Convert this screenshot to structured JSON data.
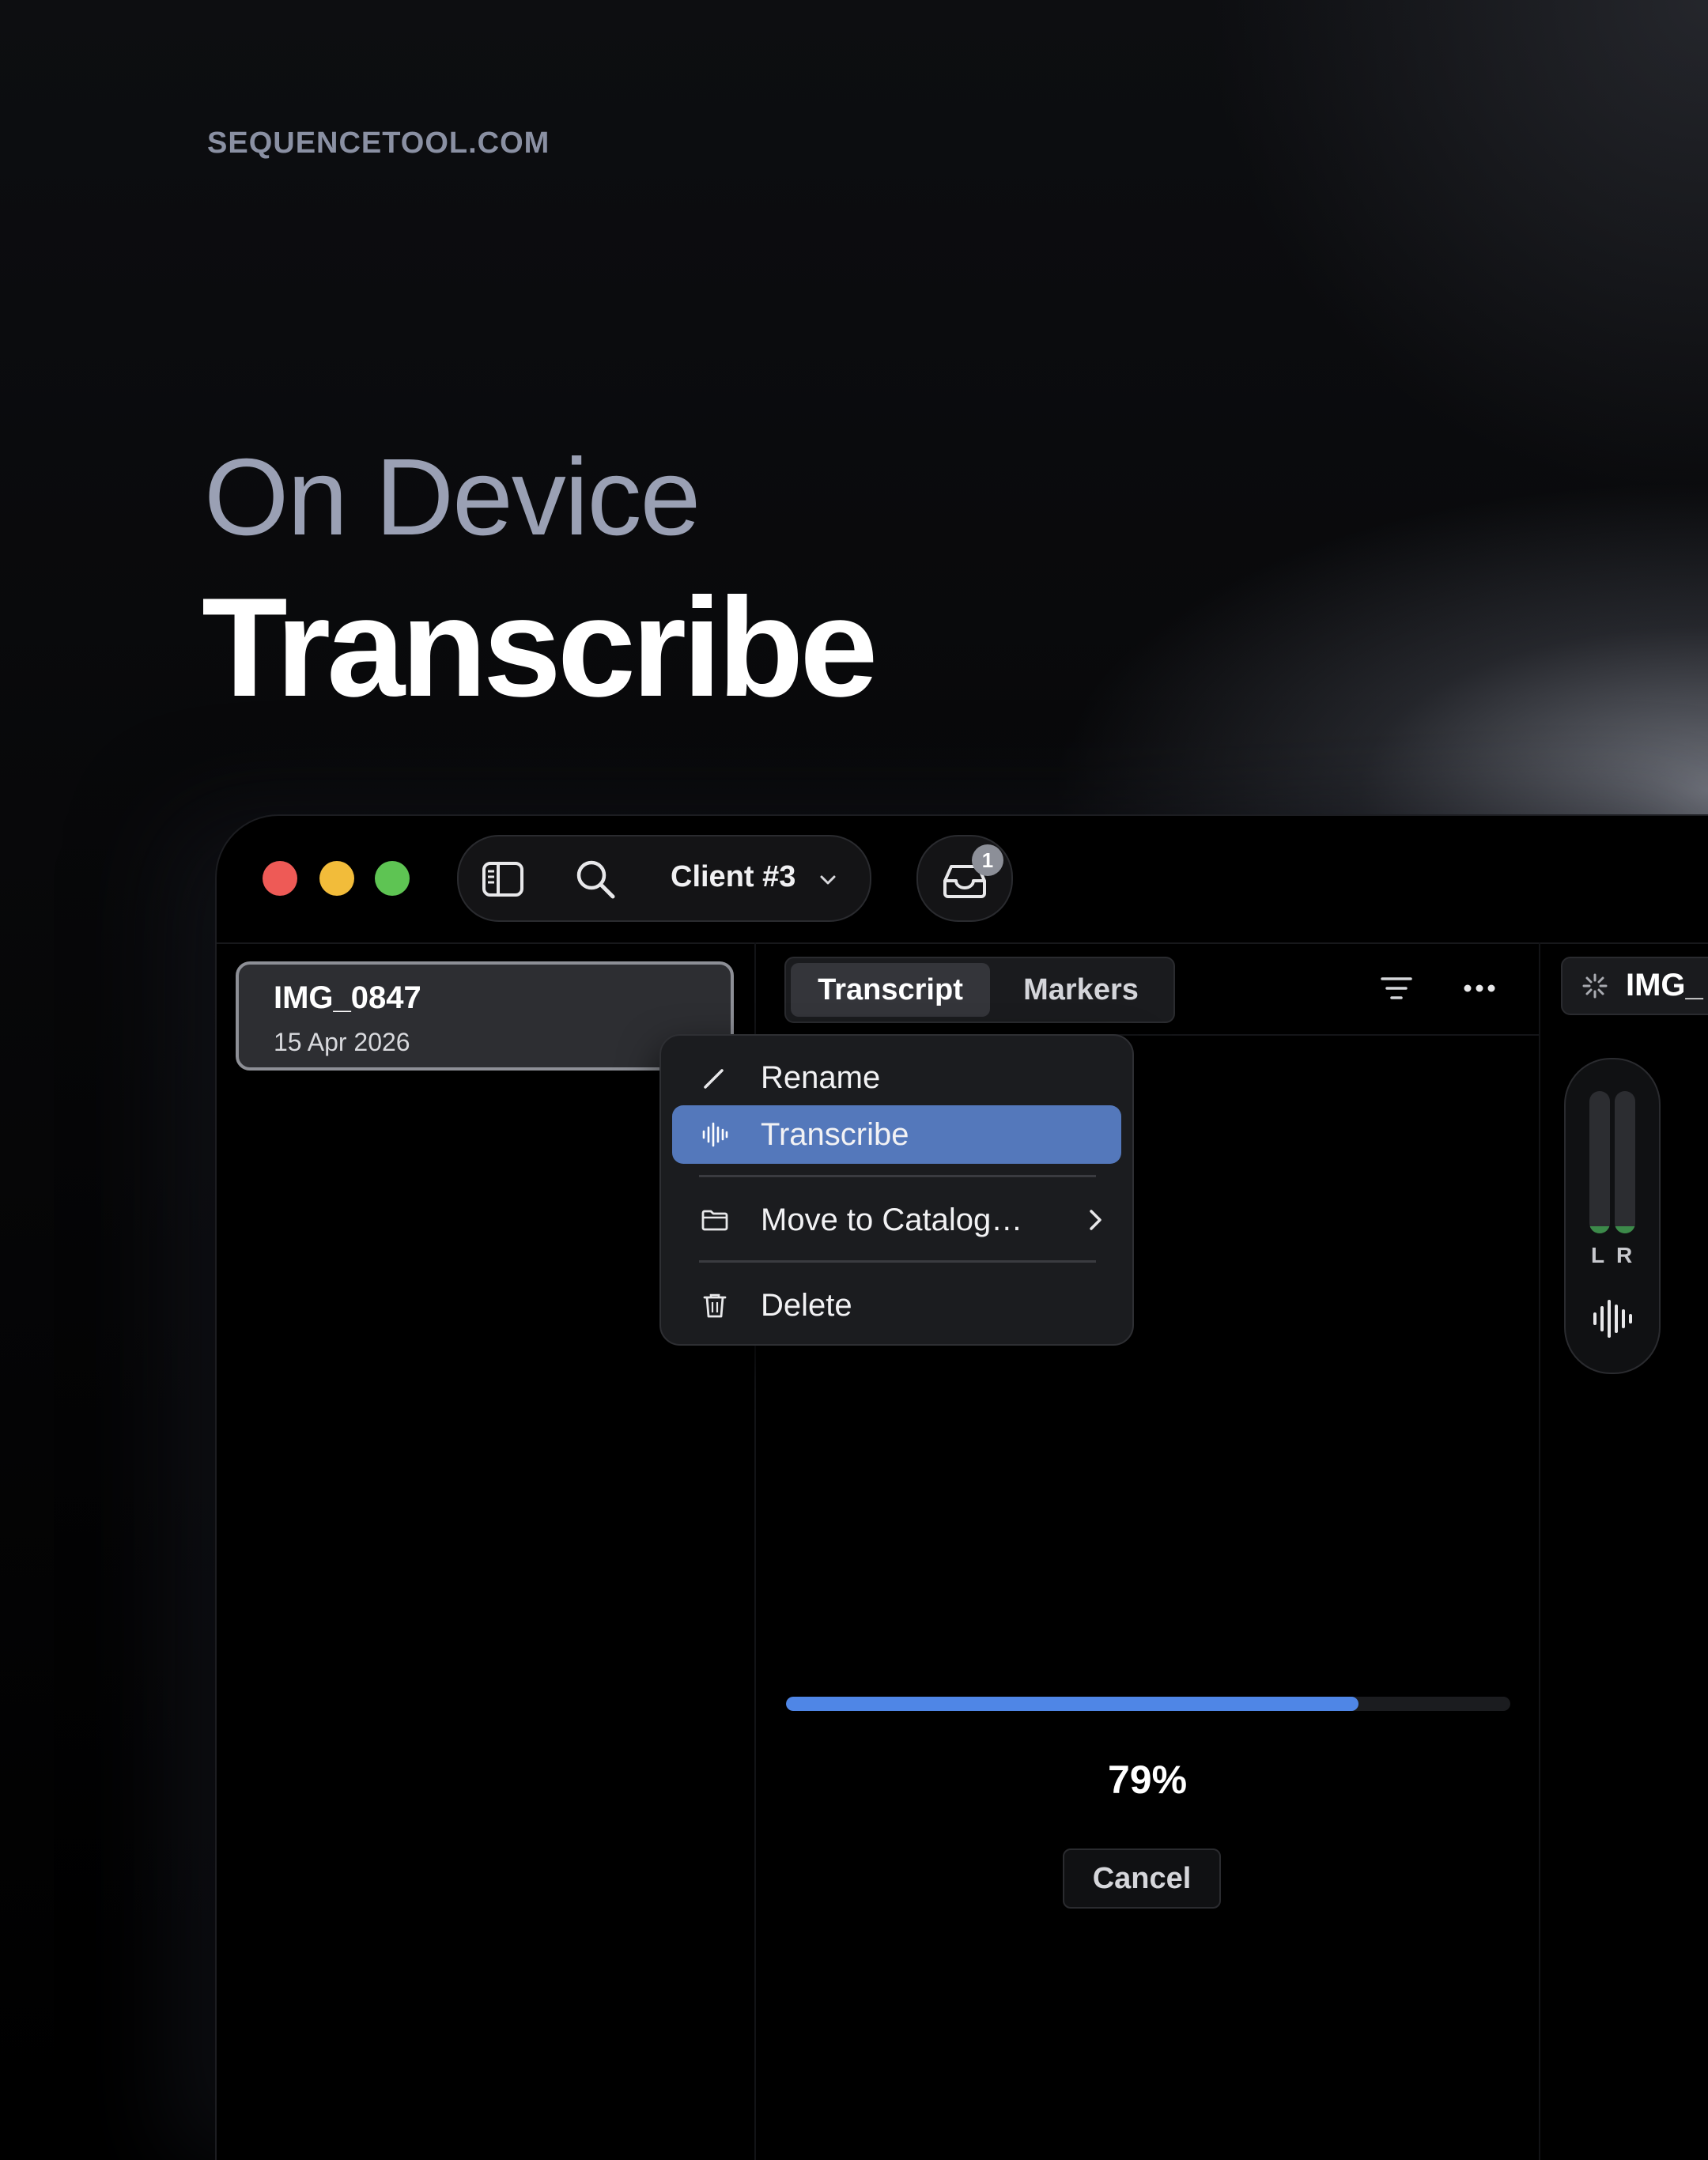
{
  "brand": "SEQUENCETOOL.COM",
  "headline": {
    "line1": "On Device",
    "line2": "Transcribe"
  },
  "toolbar": {
    "client_label": "Client #3",
    "inbox_badge": "1",
    "icons": [
      "sidebar-toggle-icon",
      "search-icon",
      "chevron-down-icon",
      "inbox-icon"
    ]
  },
  "sidebar": {
    "items": [
      {
        "name": "IMG_0847",
        "date": "15 Apr 2026"
      }
    ]
  },
  "main": {
    "tabs": [
      {
        "label": "Transcript",
        "active": true
      },
      {
        "label": "Markers",
        "active": false
      }
    ],
    "progress": {
      "value": 0.79,
      "text": "79%"
    },
    "cancel_label": "Cancel"
  },
  "context_menu": {
    "items": [
      {
        "label": "Rename",
        "icon": "pencil-icon"
      },
      {
        "label": "Transcribe",
        "icon": "waveform-icon",
        "highlighted": true
      },
      {
        "label": "Move to Catalog…",
        "icon": "folder-icon",
        "submenu": true
      },
      {
        "label": "Delete",
        "icon": "trash-icon"
      }
    ]
  },
  "right_panel": {
    "file_label": "IMG_",
    "meter": {
      "left_label": "L",
      "right_label": "R",
      "left_level": 0.05,
      "right_level": 0.05
    }
  },
  "colors": {
    "accent": "#4f86e6",
    "menu_highlight": "#5478bb",
    "traffic_red": "#ee5a56",
    "traffic_yellow": "#f2bc3a",
    "traffic_green": "#5ec453"
  }
}
